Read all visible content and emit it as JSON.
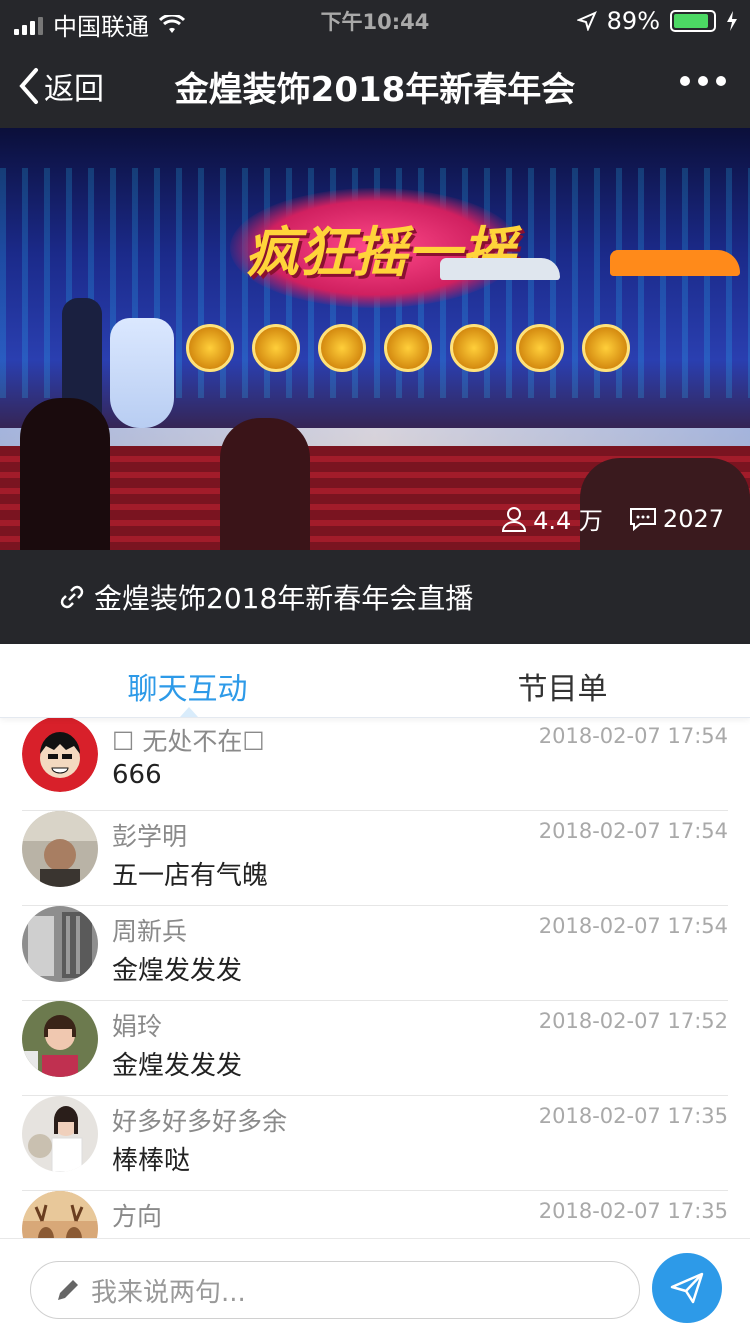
{
  "status": {
    "carrier": "中国联通",
    "time": "下午10:44",
    "battery": "89%",
    "battery_level": 0.89
  },
  "nav": {
    "back_label": "返回",
    "title": "金煌装饰2018年新春年会"
  },
  "video": {
    "banner": "疯狂摇一摇",
    "viewers": "4.4 万",
    "comments": "2027"
  },
  "link": {
    "text": "金煌装饰2018年新春年会直播"
  },
  "tabs": [
    {
      "label": "聊天互动"
    },
    {
      "label": "节目单"
    }
  ],
  "chat": [
    {
      "name": "☐ 无处不在☐",
      "time": "2018-02-07 17:54",
      "message": "666"
    },
    {
      "name": "彭学明",
      "time": "2018-02-07 17:54",
      "message": "五一店有气魄"
    },
    {
      "name": "周新兵",
      "time": "2018-02-07 17:54",
      "message": "金煌发发发"
    },
    {
      "name": "娟玲",
      "time": "2018-02-07 17:52",
      "message": "金煌发发发"
    },
    {
      "name": "好多好多好多余",
      "time": "2018-02-07 17:35",
      "message": "棒棒哒"
    },
    {
      "name": "方向",
      "time": "2018-02-07 17:35",
      "message": ""
    }
  ],
  "input": {
    "placeholder": "我来说两句..."
  },
  "colors": {
    "accent": "#2d9ae8",
    "header_bg": "#26272b"
  }
}
